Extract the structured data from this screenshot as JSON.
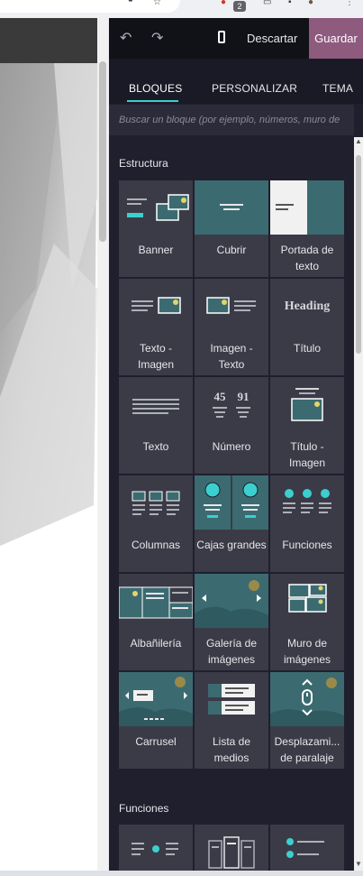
{
  "browser": {
    "notification_count": "2"
  },
  "toolbar": {
    "undo_icon": "undo-icon",
    "redo_icon": "redo-icon",
    "discard_label": "Descartar",
    "save_label": "Guardar"
  },
  "tabs": [
    {
      "label": "BLOQUES"
    },
    {
      "label": "PERSONALIZAR"
    },
    {
      "label": "TEMA"
    }
  ],
  "search": {
    "placeholder": "Buscar un bloque (por ejemplo, números, muro de"
  },
  "sections": {
    "structure": {
      "title": "Estructura"
    },
    "features": {
      "title": "Funciones"
    }
  },
  "blocks": [
    {
      "label": "Banner"
    },
    {
      "label": "Cubrir"
    },
    {
      "label": "Portada de texto"
    },
    {
      "label": "Texto - Imagen"
    },
    {
      "label": "Imagen - Texto"
    },
    {
      "label": "Título"
    },
    {
      "label": "Texto"
    },
    {
      "label": "Número"
    },
    {
      "label": "Título - Imagen"
    },
    {
      "label": "Columnas"
    },
    {
      "label": "Cajas grandes"
    },
    {
      "label": "Funciones"
    },
    {
      "label": "Albañilería"
    },
    {
      "label": "Galería de imágenes"
    },
    {
      "label": "Muro de imágenes"
    },
    {
      "label": "Carrusel"
    },
    {
      "label": "Lista de medios"
    },
    {
      "label": "Desplazami... de paralaje"
    }
  ],
  "thumb_text": {
    "heading": "Heading",
    "num1": "45",
    "num2": "91"
  },
  "colors": {
    "accent": "#3ccfcf",
    "save": "#8e5a7e",
    "tile": "#3b3b47",
    "teal": "#3b6b70"
  }
}
